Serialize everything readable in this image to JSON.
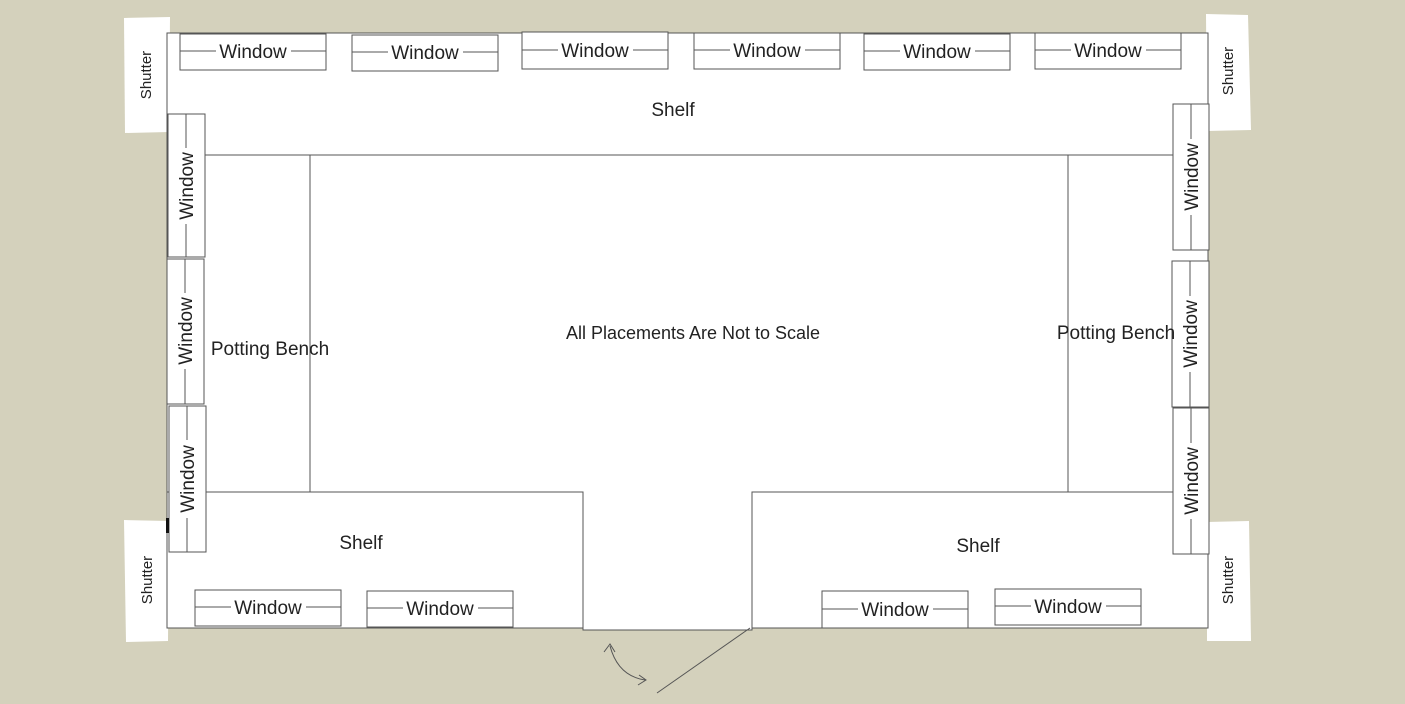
{
  "colors": {
    "background": "#d4d1bc",
    "floor": "#ffffff",
    "line": "#555555",
    "text": "#222222"
  },
  "labels": {
    "top_shelf": "Shelf",
    "bottom_left_shelf": "Shelf",
    "bottom_right_shelf": "Shelf",
    "left_bench": "Potting Bench",
    "right_bench": "Potting Bench",
    "center_note": "All Placements Are Not to Scale",
    "window": "Window",
    "shutter": "Shutter"
  },
  "windows": {
    "top_count": 6,
    "left_count": 3,
    "right_count": 3,
    "bottom_left_count": 2,
    "bottom_right_count": 2
  },
  "shutters": {
    "count": 4
  },
  "door": {
    "swing_icon": "curved-double-arrow"
  }
}
